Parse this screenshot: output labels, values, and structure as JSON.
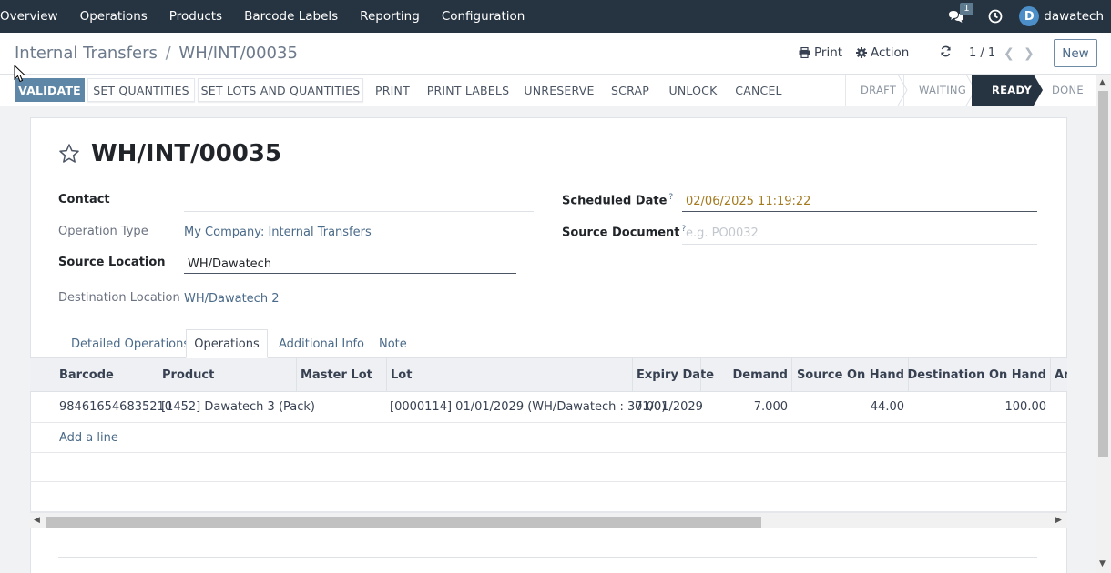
{
  "navbar": {
    "menu": [
      "Overview",
      "Operations",
      "Products",
      "Barcode Labels",
      "Reporting",
      "Configuration"
    ],
    "chat_count": "1",
    "user_initial": "D",
    "user_name": "dawatech"
  },
  "control": {
    "breadcrumb_parent": "Internal Transfers",
    "breadcrumb_sep": "/",
    "breadcrumb_current": "WH/INT/00035",
    "print_label": "Print",
    "action_label": "Action",
    "pager": "1 / 1",
    "new_label": "New"
  },
  "actions": {
    "validate": "VALIDATE",
    "set_quantities": "SET QUANTITIES",
    "set_lots": "SET LOTS AND QUANTITIES",
    "print": "PRINT",
    "print_labels": "PRINT LABELS",
    "unreserve": "UNRESERVE",
    "scrap": "SCRAP",
    "unlock": "UNLOCK",
    "cancel": "CANCEL"
  },
  "status_stages": [
    "DRAFT",
    "WAITING",
    "READY",
    "DONE"
  ],
  "status_active": "READY",
  "form": {
    "title": "WH/INT/00035",
    "contact_label": "Contact",
    "contact_value": "",
    "operation_type_label": "Operation Type",
    "operation_type_value": "My Company: Internal Transfers",
    "source_location_label": "Source Location",
    "source_location_value": "WH/Dawatech",
    "destination_location_label": "Destination Location",
    "destination_location_value": "WH/Dawatech 2",
    "scheduled_date_label": "Scheduled Date",
    "scheduled_date_value": "02/06/2025 11:19:22",
    "source_document_label": "Source Document",
    "source_document_placeholder": "e.g. PO0032",
    "help_mark": "?"
  },
  "tabs": [
    "Detailed Operations",
    "Operations",
    "Additional Info",
    "Note"
  ],
  "table": {
    "columns": [
      "Barcode",
      "Product",
      "Master Lot",
      "Lot",
      "Expiry Date",
      "Demand",
      "Source On Hand",
      "Destination On Hand",
      "Am"
    ],
    "rows": [
      {
        "barcode": "984616546835210",
        "product": "[1452] Dawatech 3 (Pack)",
        "master_lot": "",
        "lot": "[0000114] 01/01/2029 (WH/Dawatech : 37.00)",
        "expiry": "01/01/2029",
        "demand": "7.000",
        "source_on_hand": "44.00",
        "destination_on_hand": "100.00"
      }
    ],
    "add_line": "Add a line"
  },
  "colors": {
    "navbar": "#263340",
    "primary": "#5e86a6",
    "link": "#4a6a89",
    "scheduled_date": "#a47a1f"
  }
}
